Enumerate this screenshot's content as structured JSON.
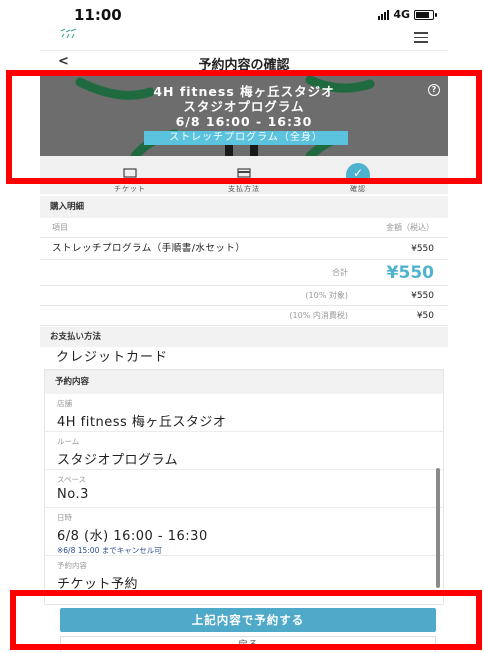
{
  "status_bar": {
    "time": "11:00",
    "network": "4G"
  },
  "app_bar": {
    "logo": "four h"
  },
  "nav": {
    "back": "<",
    "title": "予約内容の確認"
  },
  "hero": {
    "line1": "4H fitness 梅ヶ丘スタジオ",
    "line2": "スタジオプログラム",
    "line3": "6/8  16:00 - 16:30",
    "badge": "ストレッチプログラム（全身）",
    "help": "?"
  },
  "steps": [
    {
      "label": "チケット",
      "icon": "ticket-icon"
    },
    {
      "label": "支払方法",
      "icon": "card-icon"
    },
    {
      "label": "確認",
      "icon": "check-icon"
    }
  ],
  "purchase": {
    "section_title": "購入明細",
    "col_item": "項目",
    "col_amount": "金額（税込）",
    "item_name": "ストレッチプログラム（手順書/水セット）",
    "item_price": "¥550",
    "total_label": "合計",
    "total_value": "¥550",
    "tax_target_label": "(10% 対象)",
    "tax_target_value": "¥550",
    "tax_included_label": "(10% 内消費税)",
    "tax_included_value": "¥50"
  },
  "payment": {
    "section_title": "お支払い方法",
    "method": "クレジットカード"
  },
  "reservation": {
    "section_title": "予約内容",
    "fields": [
      {
        "label": "店舗",
        "value": "4H fitness 梅ヶ丘スタジオ"
      },
      {
        "label": "ルーム",
        "value": "スタジオプログラム"
      },
      {
        "label": "スペース",
        "value": "No.3"
      },
      {
        "label": "日時",
        "value": "6/8 (水) 16:00 - 16:30",
        "note": "※6/8 15:00 までキャンセル可"
      },
      {
        "label": "予約内容",
        "value": "チケット予約"
      }
    ]
  },
  "actions": {
    "reserve": "上記内容で予約する",
    "back": "戻る"
  },
  "colors": {
    "accent": "#4fb3cf",
    "button": "#4fa9c8",
    "highlight": "#ff0000",
    "hero_bg": "#6d6d6d"
  }
}
